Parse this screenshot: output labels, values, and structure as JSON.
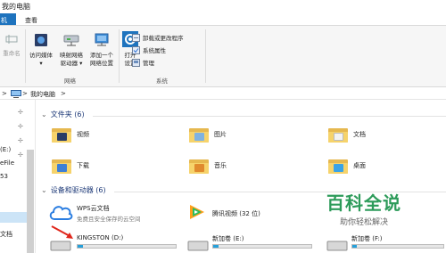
{
  "window": {
    "title": "我的电脑"
  },
  "tabs": {
    "left": "机",
    "view": "查看"
  },
  "ribbon": {
    "rename": "重命名",
    "access_media": [
      "访问媒体",
      "▾"
    ],
    "map_drive": [
      "映射网络",
      "驱动器 ▾"
    ],
    "add_location": [
      "添加一个",
      "网络位置"
    ],
    "open_settings": [
      "打开",
      "设置"
    ],
    "uninstall": "卸载或更改程序",
    "system_props": "系统属性",
    "manage": "管理",
    "group_network": "网络",
    "group_system": "系统"
  },
  "address": {
    "crumb": "我的电脑",
    "sep": ">"
  },
  "leftpane": {
    "items": [
      "(E:)",
      "eFile",
      "53",
      "文档"
    ]
  },
  "folders_header": "文件夹 (6)",
  "folders": [
    {
      "name": "视频",
      "icon": "video-folder-icon"
    },
    {
      "name": "图片",
      "icon": "pictures-folder-icon"
    },
    {
      "name": "文档",
      "icon": "documents-folder-icon"
    },
    {
      "name": "下载",
      "icon": "downloads-folder-icon"
    },
    {
      "name": "音乐",
      "icon": "music-folder-icon"
    },
    {
      "name": "桌面",
      "icon": "desktop-folder-icon"
    }
  ],
  "devices_header": "设备和驱动器 (6)",
  "devices": {
    "wps": {
      "title": "WPS云文档",
      "subtitle": "免费且安全保存的云空间"
    },
    "tencent": {
      "title": "腾讯视频 (32 位)"
    },
    "kingston": {
      "title": "KINGSTON (D:)",
      "usage": 0.05
    },
    "e_drive": {
      "title": "新加卷 (E:)",
      "usage": 0.05
    },
    "f_drive": {
      "title": "新加卷 (F:)",
      "usage": 0.05
    }
  },
  "watermark": {
    "big": "百科全说",
    "small": "助你轻松解决"
  },
  "colors": {
    "accent": "#1e73be",
    "folder": "#f6d36b",
    "watermark": "#2d9b5a",
    "bar_fill": "#26a0da"
  }
}
